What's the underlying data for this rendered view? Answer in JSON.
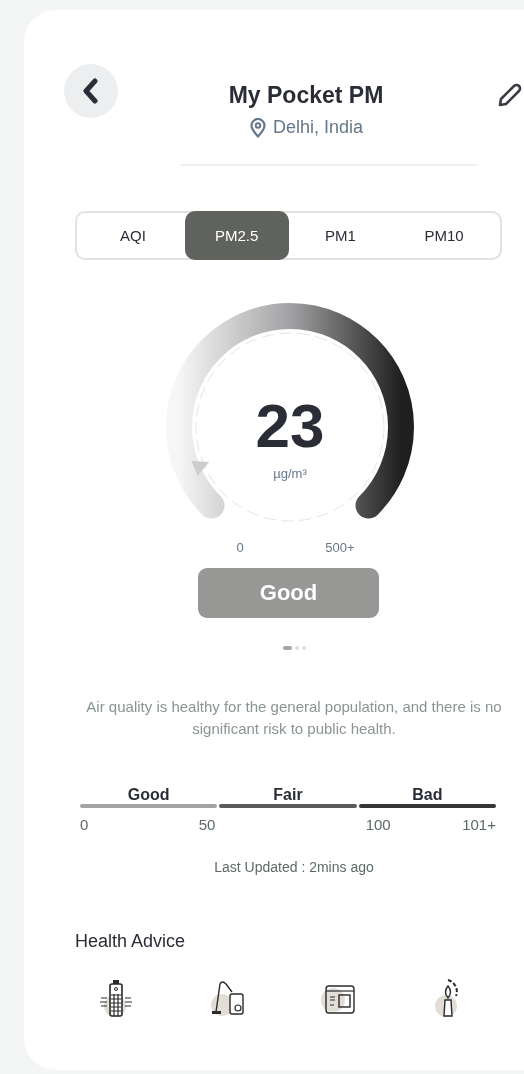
{
  "header": {
    "title": "My Pocket PM",
    "location": "Delhi, India"
  },
  "tabs": [
    {
      "label": "AQI",
      "selected": false
    },
    {
      "label": "PM2.5",
      "selected": true
    },
    {
      "label": "PM1",
      "selected": false
    },
    {
      "label": "PM10",
      "selected": false
    }
  ],
  "gauge": {
    "value": "23",
    "unit": "µg/m³",
    "min_label": "0",
    "max_label": "500+",
    "level": 0.08
  },
  "status": {
    "label": "Good"
  },
  "pager": [
    {
      "selected": true
    },
    {
      "selected": false
    },
    {
      "selected": false
    }
  ],
  "description": "Air quality is healthy for the general population, and there is no significant risk to public health.",
  "scale": {
    "segments": [
      {
        "label": "Good",
        "color": "#a3a3a1"
      },
      {
        "label": "Fair",
        "color": "#5b5b59"
      },
      {
        "label": "Bad",
        "color": "#353535"
      }
    ],
    "ticks": [
      "0",
      "50",
      "100",
      "101+"
    ]
  },
  "last_updated": "Last Updated : 2mins ago",
  "health_advice": {
    "title": "Health Advice",
    "items": [
      {
        "kind": "purifier"
      },
      {
        "kind": "vacuum"
      },
      {
        "kind": "screen"
      },
      {
        "kind": "candle"
      }
    ]
  }
}
